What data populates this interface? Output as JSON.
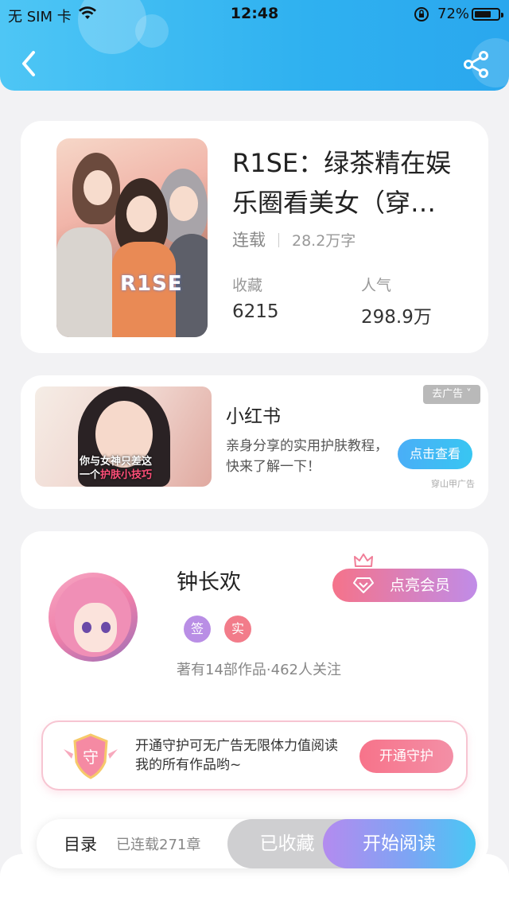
{
  "status_bar": {
    "carrier": "无 SIM 卡",
    "time": "12:48",
    "battery": "72%",
    "battery_level": 0.72
  },
  "nav": {
    "back_icon": "chevron-left-icon",
    "share_icon": "share-icon"
  },
  "book": {
    "title": "R1SE：绿茶精在娱乐圈看美女（穿…",
    "cover_text": "R1SE",
    "status": "连载",
    "words": "28.2万字",
    "collect_label": "收藏",
    "collect_value": "6215",
    "popularity_label": "人气",
    "popularity_value": "298.9万"
  },
  "ad": {
    "image_caption_1": "你与女神只差这",
    "image_caption_2a": "一个",
    "image_caption_2b": "护肤小技巧",
    "close_label": "去广告 ˅",
    "title": "小红书",
    "description": "亲身分享的实用护肤教程，快来了解一下！",
    "button": "点击查看",
    "source": "穿山甲广告"
  },
  "author": {
    "name": "钟长欢",
    "badge_sign": "签",
    "badge_real": "实",
    "stats": "著有14部作品·462人关注",
    "vip_button": "点亮会员",
    "guard_icon_text": "守",
    "guard_text": "开通守护可无广告无限体力值阅读我的所有作品哟~",
    "guard_button": "开通守护"
  },
  "bottom": {
    "toc": "目录",
    "chapters": "已连载271章",
    "favorited": "已收藏",
    "start_reading": "开始阅读"
  },
  "colors": {
    "header": "#2fb1f0",
    "accent_blue": "#38c6f2",
    "accent_pink": "#f5738a",
    "accent_purple": "#b48bef"
  }
}
